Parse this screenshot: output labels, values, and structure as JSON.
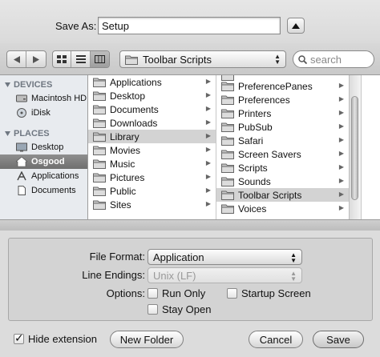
{
  "save_as": {
    "label": "Save As:",
    "value": "Setup"
  },
  "toolbar": {
    "path_popup": "Toolbar Scripts",
    "search_placeholder": "search"
  },
  "sidebar": {
    "devices_header": "DEVICES",
    "devices": [
      "Macintosh HD",
      "iDisk"
    ],
    "places_header": "PLACES",
    "places": [
      "Desktop",
      "Osgood",
      "Applications",
      "Documents"
    ],
    "selected": "Osgood"
  },
  "column1": {
    "items": [
      "Applications",
      "Desktop",
      "Documents",
      "Downloads",
      "Library",
      "Movies",
      "Music",
      "Pictures",
      "Public",
      "Sites"
    ],
    "selected": "Library"
  },
  "column2": {
    "items": [
      "PreferencePanes",
      "Preferences",
      "Printers",
      "PubSub",
      "Safari",
      "Screen Savers",
      "Scripts",
      "Sounds",
      "Toolbar Scripts",
      "Voices"
    ],
    "selected": "Toolbar Scripts"
  },
  "options": {
    "file_format_label": "File Format:",
    "file_format_value": "Application",
    "line_endings_label": "Line Endings:",
    "line_endings_value": "Unix (LF)",
    "options_label": "Options:",
    "run_only": "Run Only",
    "startup_screen": "Startup Screen",
    "stay_open": "Stay Open"
  },
  "footer": {
    "hide_extension": "Hide extension",
    "new_folder": "New Folder",
    "cancel": "Cancel",
    "save": "Save"
  }
}
